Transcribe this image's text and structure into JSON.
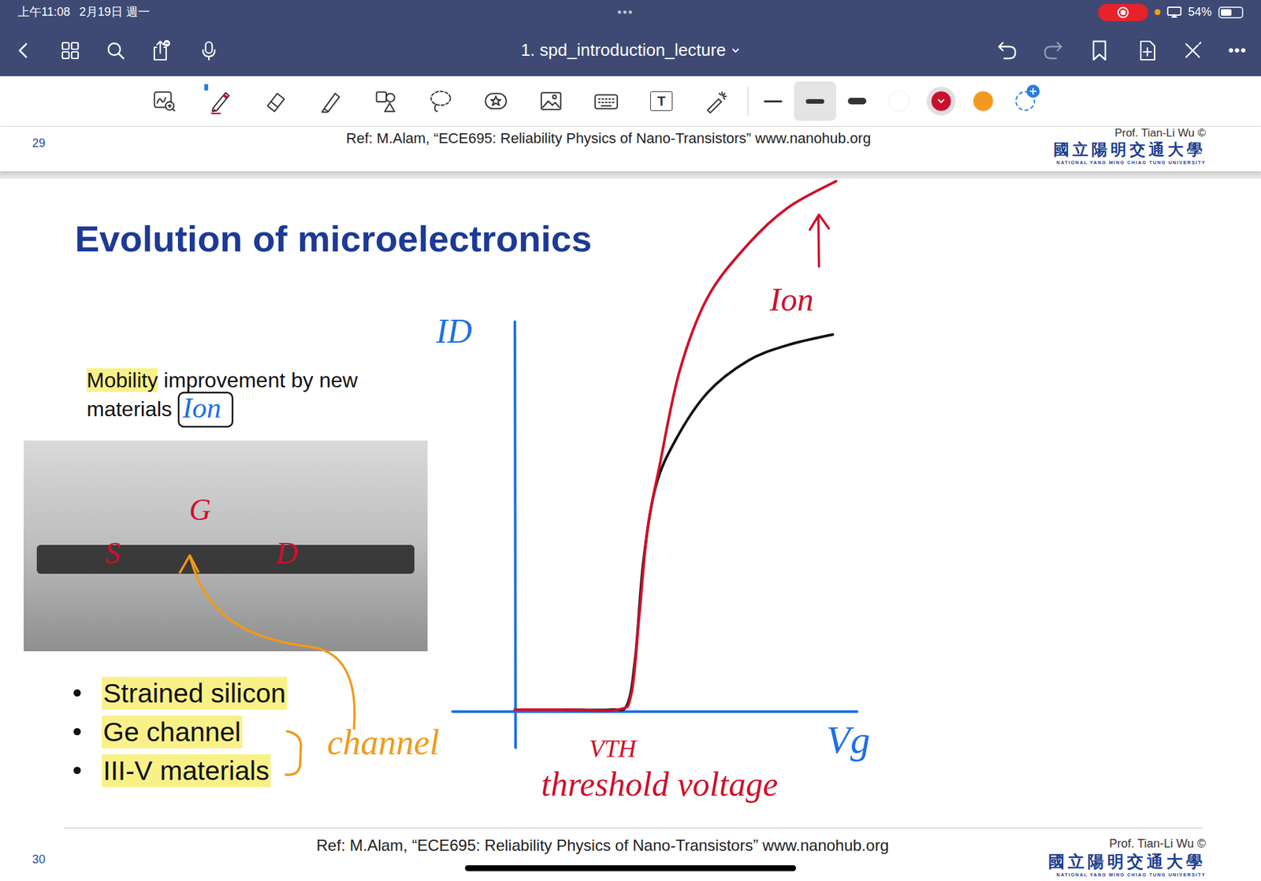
{
  "status_bar": {
    "time": "上午11:08",
    "date": "2月19日 週一",
    "dots": "•••",
    "recording": true,
    "mic_in_use": true,
    "battery": "54%",
    "battery_level": 0.54
  },
  "nav": {
    "title": "1. spd_introduction_lecture",
    "more": "•••"
  },
  "toolbar": {
    "tools": [
      {
        "kind": "zoom-pen",
        "selected": false
      },
      {
        "kind": "pen",
        "selected": true
      },
      {
        "kind": "eraser",
        "selected": false
      },
      {
        "kind": "highlighter",
        "selected": false
      },
      {
        "kind": "shapes",
        "selected": false
      },
      {
        "kind": "lasso",
        "selected": false
      },
      {
        "kind": "sticker",
        "selected": false
      },
      {
        "kind": "image",
        "selected": false
      },
      {
        "kind": "keyboard",
        "selected": false
      },
      {
        "kind": "text",
        "selected": false,
        "glyph": "T"
      },
      {
        "kind": "laser",
        "selected": false
      }
    ],
    "stroke_widths": [
      {
        "kind": "thin",
        "selected": false
      },
      {
        "kind": "medium",
        "selected": true
      },
      {
        "kind": "thick",
        "selected": false
      }
    ],
    "colors": [
      {
        "color": "#ffffff",
        "selected": false
      },
      {
        "color": "#c8102e",
        "selected": true
      },
      {
        "color": "#f39a1e",
        "selected": false
      }
    ]
  },
  "previous_page": {
    "number": "29",
    "ref": "Ref: M.Alam, “ECE695: Reliability Physics of Nano-Transistors” www.nanohub.org",
    "author": "Prof. Tian-Li Wu ©",
    "university": "國立陽明交通大學",
    "university_en": "NATIONAL YANG MING CHIAO TUNG UNIVERSITY"
  },
  "slide": {
    "number": "30",
    "title": "Evolution of microelectronics",
    "intro": [
      {
        "text": "Mobility",
        "highlighted": true
      },
      {
        "text": " improvement by new materials",
        "highlighted": false
      }
    ],
    "bullets": [
      {
        "text": "Strained silicon",
        "highlighted": true
      },
      {
        "text": "Ge channel",
        "highlighted": true
      },
      {
        "text": "III-V materials",
        "highlighted": true
      }
    ],
    "ref": "Ref: M.Alam, “ECE695: Reliability Physics of Nano-Transistors” www.nanohub.org",
    "author": "Prof. Tian-Li Wu ©",
    "university": "國立陽明交通大學",
    "university_en": "NATIONAL YANG MING CHIAO TUNG UNIVERSITY"
  },
  "annotations": {
    "ion_note": {
      "text": "Ion"
    },
    "source": {
      "text": "S"
    },
    "gate": {
      "text": "G"
    },
    "drain": {
      "text": "D"
    },
    "channel": {
      "text": "channel"
    }
  },
  "chart": {
    "y_label": "ID",
    "x_label": "Vg",
    "vth": "VTH",
    "vth_caption": "threshold voltage",
    "ion": "Ion",
    "series": [
      {
        "color": "#111111",
        "points": [
          [
            0,
            0
          ],
          [
            0.15,
            0
          ],
          [
            0.3,
            0
          ],
          [
            0.35,
            0.01
          ],
          [
            0.375,
            0.1
          ],
          [
            0.4,
            0.28
          ],
          [
            0.4375,
            0.42
          ],
          [
            0.5,
            0.51
          ],
          [
            0.6,
            0.6
          ],
          [
            0.725,
            0.66
          ],
          [
            0.85,
            0.69
          ],
          [
            0.99,
            0.71
          ]
        ]
      },
      {
        "color": "#d0102a",
        "points": [
          [
            0,
            0
          ],
          [
            0.15,
            0
          ],
          [
            0.32,
            0
          ],
          [
            0.3625,
            0.03
          ],
          [
            0.3875,
            0.18
          ],
          [
            0.4125,
            0.34
          ],
          [
            0.45,
            0.46
          ],
          [
            0.5125,
            0.64
          ],
          [
            0.6,
            0.78
          ],
          [
            0.725,
            0.88
          ],
          [
            0.85,
            0.95
          ],
          [
            1,
            1
          ]
        ]
      }
    ]
  }
}
